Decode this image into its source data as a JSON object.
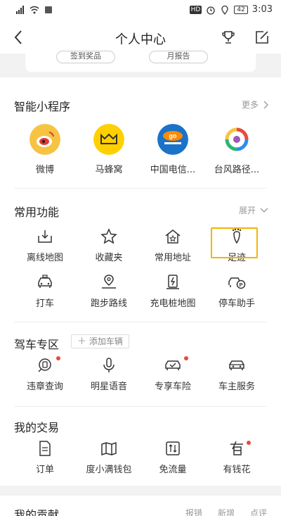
{
  "status_bar": {
    "time": "3:03",
    "battery": "42",
    "badge": "HD"
  },
  "nav": {
    "title": "个人中心"
  },
  "top_card": {
    "pill_left": "签到奖品",
    "pill_right": "月报告"
  },
  "mini_programs": {
    "title": "智能小程序",
    "more": "更多",
    "items": [
      {
        "label": "微博",
        "icon": "weibo-icon",
        "color": "#f6c343"
      },
      {
        "label": "马蜂窝",
        "icon": "mafengwo-icon",
        "color": "#ffd000"
      },
      {
        "label": "中国电信...",
        "icon": "china-telecom-icon",
        "color": "#1a73c9"
      },
      {
        "label": "台风路径...",
        "icon": "typhoon-icon",
        "color": "#ffffff"
      }
    ]
  },
  "common": {
    "title": "常用功能",
    "expand": "展开",
    "items": [
      {
        "label": "离线地图",
        "icon": "offline-map-icon"
      },
      {
        "label": "收藏夹",
        "icon": "star-icon"
      },
      {
        "label": "常用地址",
        "icon": "home-star-icon"
      },
      {
        "label": "足迹",
        "icon": "footprint-icon"
      },
      {
        "label": "打车",
        "icon": "taxi-icon"
      },
      {
        "label": "跑步路线",
        "icon": "running-route-icon"
      },
      {
        "label": "充电桩地图",
        "icon": "charging-pile-icon"
      },
      {
        "label": "停车助手",
        "icon": "parking-icon"
      }
    ]
  },
  "driving": {
    "title": "驾车专区",
    "add_car": "添加车辆",
    "items": [
      {
        "label": "违章查询",
        "icon": "violation-icon",
        "dot": true
      },
      {
        "label": "明星语音",
        "icon": "microphone-icon",
        "dot": false
      },
      {
        "label": "专享车险",
        "icon": "car-insurance-icon",
        "dot": true
      },
      {
        "label": "车主服务",
        "icon": "car-service-icon",
        "dot": false
      }
    ]
  },
  "trades": {
    "title": "我的交易",
    "items": [
      {
        "label": "订单",
        "icon": "order-icon",
        "dot": false
      },
      {
        "label": "度小满钱包",
        "icon": "wallet-icon",
        "dot": false
      },
      {
        "label": "免流量",
        "icon": "free-data-icon",
        "dot": false
      },
      {
        "label": "有钱花",
        "icon": "loan-icon",
        "dot": true
      }
    ]
  },
  "contribution": {
    "title": "我的贡献",
    "links": [
      "报错",
      "新增",
      "点评"
    ]
  }
}
